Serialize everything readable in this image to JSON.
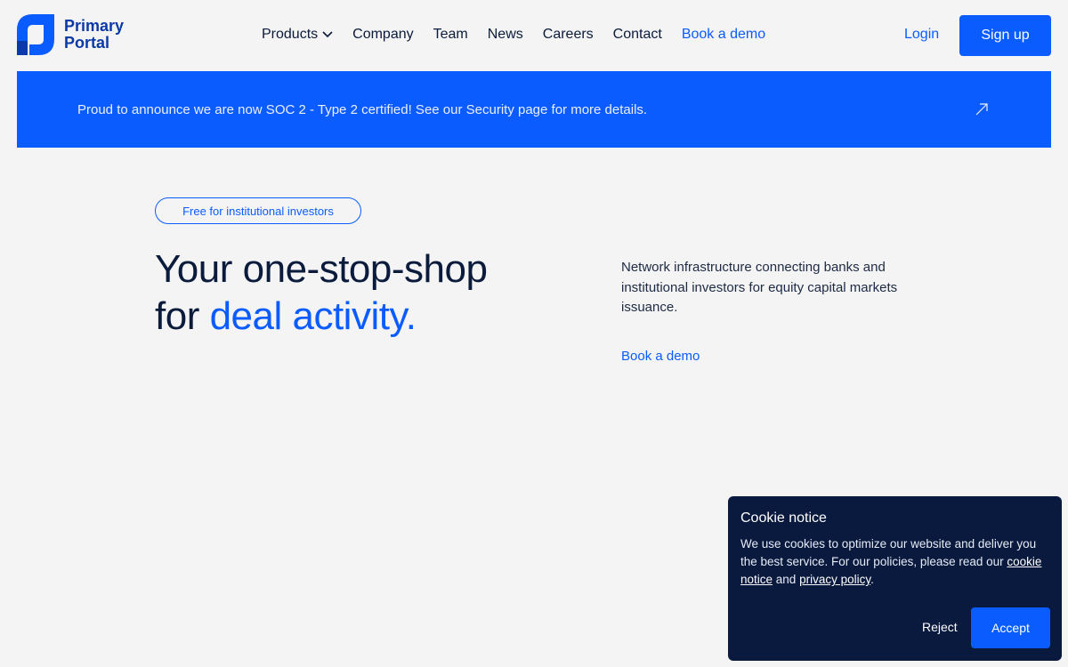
{
  "brand": {
    "line1": "Primary",
    "line2": "Portal",
    "color": "#0b3aa8"
  },
  "nav": {
    "items": [
      {
        "label": "Products"
      },
      {
        "label": "Company"
      },
      {
        "label": "Team"
      },
      {
        "label": "News"
      },
      {
        "label": "Careers"
      },
      {
        "label": "Contact"
      },
      {
        "label": "Book a demo"
      }
    ],
    "login": "Login",
    "signup": "Sign up"
  },
  "banner": {
    "text": "Proud to announce we are now SOC 2 - Type 2 certified! See our Security page for more details.",
    "icon": "arrow-up-right-icon"
  },
  "hero": {
    "pill": "Free for institutional investors",
    "headline_line1": "Your one-stop-shop",
    "headline_line2_prefix": "for ",
    "headline_accent": "deal activity.",
    "description": "Network infrastructure connecting banks and institutional investors for equity capital markets issuance.",
    "cta": "Book a demo"
  },
  "cookie": {
    "title": "Cookie notice",
    "body_prefix": "We use cookies to optimize our website and deliver you the best service. For our policies, please read our ",
    "link1": "cookie notice",
    "and": " and ",
    "link2": "privacy policy",
    "period": ".",
    "reject": "Reject",
    "accept": "Accept"
  },
  "colors": {
    "accent": "#0b5cff",
    "dark": "#0a1a3e",
    "background": "#f4f4f4"
  }
}
